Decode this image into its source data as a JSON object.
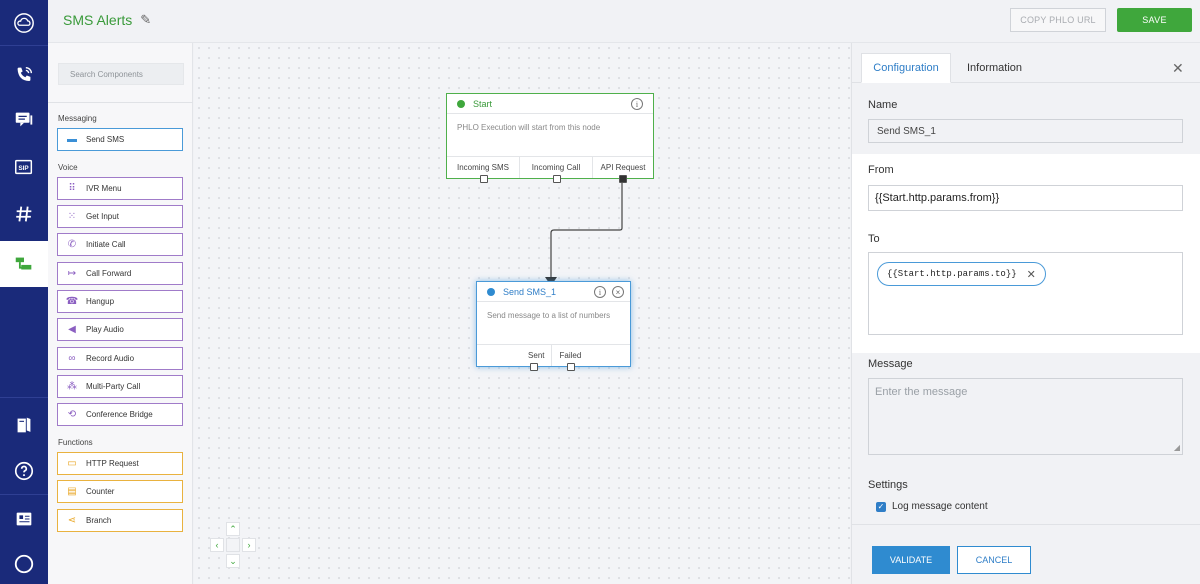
{
  "header": {
    "title": "SMS Alerts",
    "copy_label": "COPY PHLO URL",
    "save_label": "SAVE"
  },
  "components": {
    "search_placeholder": "Search Components",
    "messaging_label": "Messaging",
    "voice_label": "Voice",
    "functions_label": "Functions",
    "messaging": [
      {
        "label": "Send SMS",
        "icon": "sms-icon"
      }
    ],
    "voice": [
      {
        "label": "IVR Menu",
        "icon": "keypad-icon"
      },
      {
        "label": "Get Input",
        "icon": "input-icon"
      },
      {
        "label": "Initiate Call",
        "icon": "phone-icon"
      },
      {
        "label": "Call Forward",
        "icon": "forward-icon"
      },
      {
        "label": "Hangup",
        "icon": "hangup-icon"
      },
      {
        "label": "Play Audio",
        "icon": "speaker-icon"
      },
      {
        "label": "Record Audio",
        "icon": "voicemail-icon"
      },
      {
        "label": "Multi-Party Call",
        "icon": "multiparty-icon"
      },
      {
        "label": "Conference Bridge",
        "icon": "conference-icon"
      }
    ],
    "functions": [
      {
        "label": "HTTP Request",
        "icon": "http-icon"
      },
      {
        "label": "Counter",
        "icon": "counter-icon"
      },
      {
        "label": "Branch",
        "icon": "branch-icon"
      }
    ]
  },
  "canvas": {
    "start_node": {
      "title": "Start",
      "description": "PHLO Execution will start from this node",
      "ports": [
        "Incoming SMS",
        "Incoming Call",
        "API Request"
      ]
    },
    "sms_node": {
      "title": "Send SMS_1",
      "description": "Send message to a list of numbers",
      "ports": [
        "Sent",
        "Failed"
      ]
    }
  },
  "panel": {
    "tab_config": "Configuration",
    "tab_info": "Information",
    "name_label": "Name",
    "name_value": "Send SMS_1",
    "from_label": "From",
    "from_value": "{{Start.http.params.from}}",
    "to_label": "To",
    "to_chip": "{{Start.http.params.to}}",
    "message_label": "Message",
    "message_placeholder": "Enter the message",
    "settings_label": "Settings",
    "log_label": "Log message content",
    "log_checked": true,
    "validate_label": "VALIDATE",
    "cancel_label": "CANCEL"
  },
  "colors": {
    "rail": "#1a2a7a",
    "green": "#3fa73c",
    "blue": "#2f8bd0",
    "purple": "#a07bc9",
    "orange": "#e9b23f"
  }
}
